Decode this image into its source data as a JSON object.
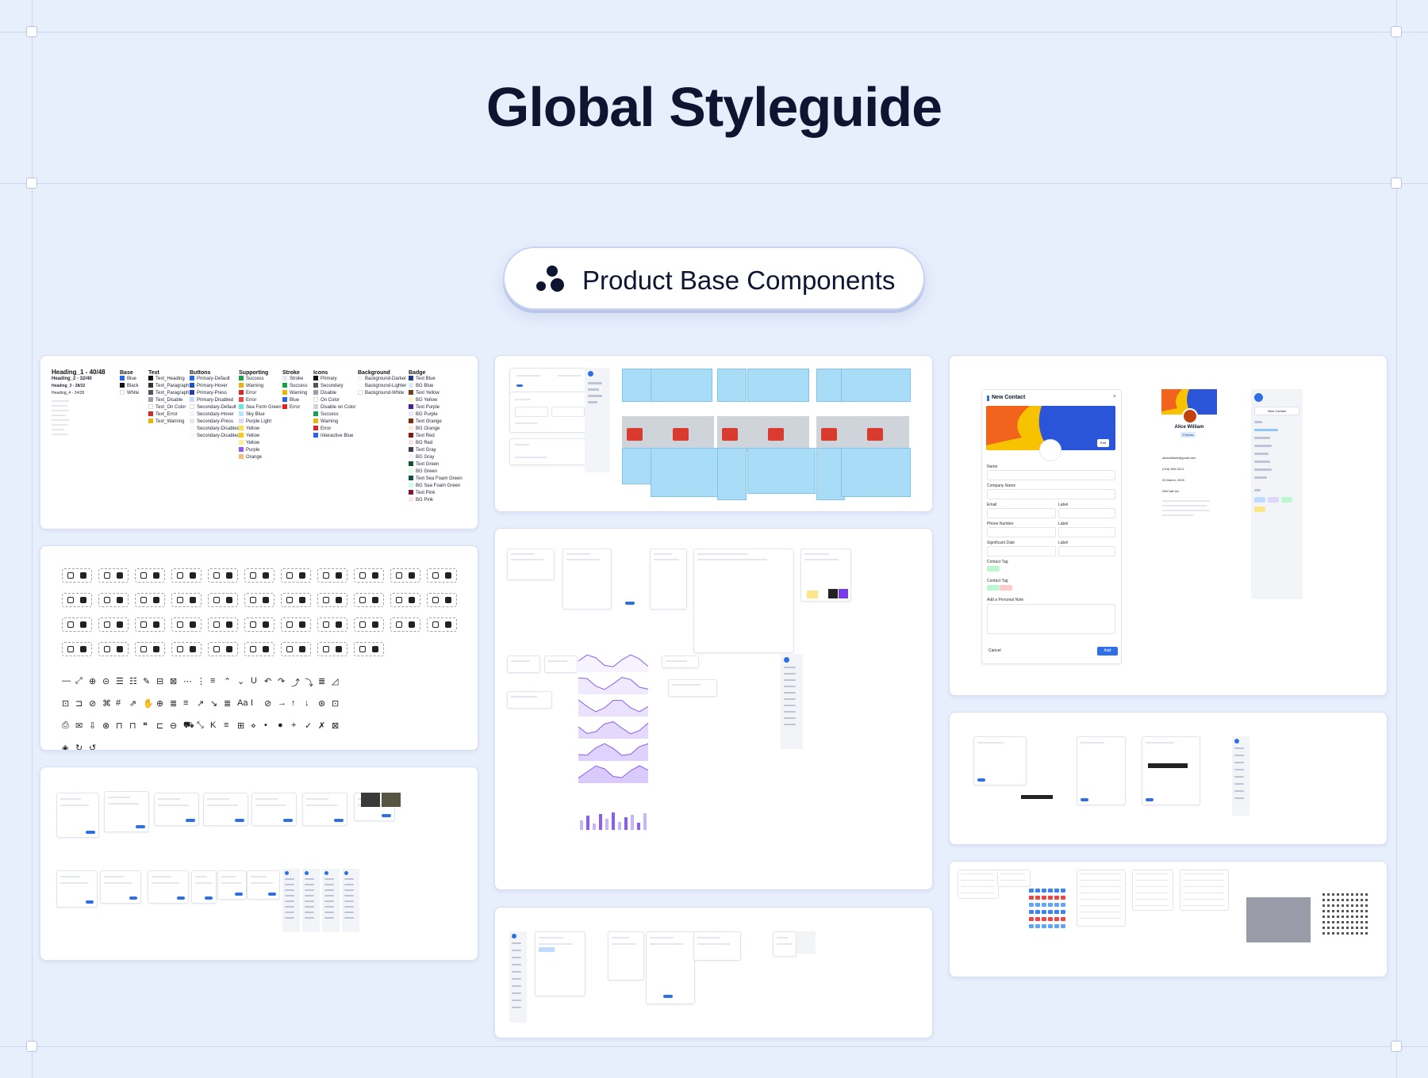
{
  "header": {
    "title": "Global Styleguide"
  },
  "pill": {
    "label": "Product Base Components"
  },
  "colors": {
    "background": "#e7eefc",
    "title": "#0d1530",
    "accent": "#2f6fe6",
    "tile": "#a9dcf7"
  },
  "styles_card": {
    "headings": [
      "Heading_1 - 40/48",
      "Heading_2 - 32/40",
      "Heading_3 - 28/32",
      "Heading_4 - 24/28"
    ],
    "columns": [
      {
        "title": "Base",
        "items": [
          "Blue",
          "Black",
          "White"
        ]
      },
      {
        "title": "Text",
        "items": [
          "Text_Heading",
          "Text_Paragraph",
          "Text_Paragraph",
          "Text_Disable",
          "Text_On Color",
          "Text_Error",
          "Text_Warning"
        ]
      },
      {
        "title": "Buttons",
        "items": [
          "Primary-Default",
          "Primary-Hover",
          "Primary-Press",
          "Primary-Disabled",
          "Secondary-Default",
          "Secondary-Hover",
          "Secondary-Press",
          "Secondary-Disabled",
          "Secondary-Disabled"
        ]
      },
      {
        "title": "Supporting",
        "items": [
          "Success",
          "Warning",
          "Error",
          "Error",
          "Sea Form Green",
          "Sky Blue",
          "Purple Light",
          "Yellow",
          "Yellow",
          "Yellow",
          "Purple",
          "Orange"
        ]
      },
      {
        "title": "Stroke",
        "items": [
          "Stroke",
          "Success",
          "Warning",
          "Blue",
          "Error"
        ]
      },
      {
        "title": "Icons",
        "items": [
          "Primary",
          "Secondary",
          "Disable",
          "On Color",
          "Disable on Color",
          "Success",
          "Warning",
          "Error",
          "Interactive Blue"
        ]
      },
      {
        "title": "Background",
        "items": [
          "Background-Darker",
          "Background-Lighter",
          "Background-White"
        ]
      },
      {
        "title": "Badge",
        "items": [
          "Text Blue",
          "BG Blue",
          "Text Yellow",
          "BG Yellow",
          "Text Purple",
          "BG Purple",
          "Text Orange",
          "BG Orange",
          "Text Red",
          "BG Red",
          "Text Gray",
          "BG Gray",
          "Text Green",
          "BG Green",
          "Text Sea Foam Green",
          "BG Sea Foam Green",
          "Text Pink",
          "BG Pink"
        ]
      }
    ]
  },
  "contact_card": {
    "dialog_title": "New Contact",
    "edit_label": "Edit",
    "fields": [
      "Name",
      "Company Name",
      "Email",
      "Label",
      "Phone Number",
      "Label",
      "Significant Date",
      "Label",
      "Contact Tag",
      "Contact Tag",
      "Add a Personal Note"
    ],
    "cancel_label": "Cancel",
    "add_label": "Add",
    "profile_name": "Alice William",
    "profile_badge": "Friends",
    "profile_email": "alicewilliam@gmail.com",
    "profile_phone": "(218) 555-0114",
    "profile_date": "03 March, 2000",
    "profile_company": "WeCraft Inc.",
    "new_contact_button": "New Contact"
  }
}
